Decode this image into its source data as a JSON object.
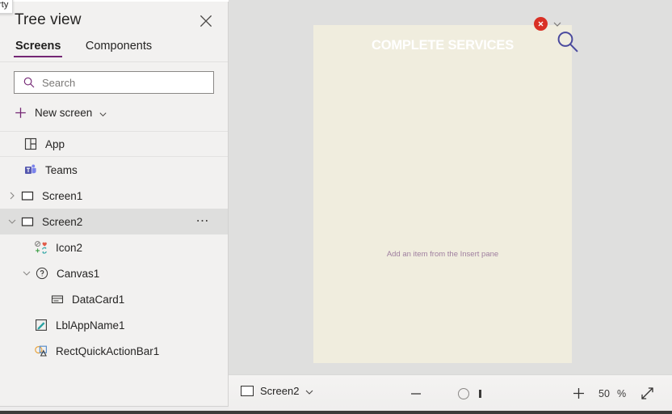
{
  "tooltip_fragment": "erty",
  "tree_view": {
    "title": "Tree view",
    "close_icon": "close-icon",
    "tabs": [
      {
        "label": "Screens",
        "active": true
      },
      {
        "label": "Components",
        "active": false
      }
    ],
    "search": {
      "placeholder": "Search",
      "value": "",
      "icon": "search-icon"
    },
    "new_screen": {
      "label": "New screen",
      "plus_icon": "plus-icon",
      "chevron_icon": "chevron-down-icon"
    },
    "items": [
      {
        "label": "App",
        "icon": "app-grid-icon",
        "indent": 0,
        "twisty": "none",
        "selected": false
      },
      {
        "label": "Teams",
        "icon": "teams-icon",
        "indent": 0,
        "twisty": "none",
        "selected": false
      },
      {
        "label": "Screen1",
        "icon": "screen-icon",
        "indent": 0,
        "twisty": "collapsed",
        "selected": false
      },
      {
        "label": "Screen2",
        "icon": "screen-icon",
        "indent": 0,
        "twisty": "expanded",
        "selected": true,
        "more_icon": "more-options-icon"
      },
      {
        "label": "Icon2",
        "icon": "icon-control-icon",
        "indent": 1,
        "twisty": "none",
        "selected": false
      },
      {
        "label": "Canvas1",
        "icon": "question-circle-icon",
        "indent": 1,
        "twisty": "expanded",
        "selected": false
      },
      {
        "label": "DataCard1",
        "icon": "datacard-icon",
        "indent": 2,
        "twisty": "none",
        "selected": false
      },
      {
        "label": "LblAppName1",
        "icon": "label-pencil-icon",
        "indent": 1,
        "twisty": "none",
        "selected": false
      },
      {
        "label": "RectQuickActionBar1",
        "icon": "shapes-icon",
        "indent": 1,
        "twisty": "none",
        "selected": false
      }
    ]
  },
  "canvas": {
    "error_badge": {
      "icon": "error-x-icon",
      "chevron_icon": "chevron-down-icon"
    },
    "app_screen": {
      "title": "COMPLETE SERVICES",
      "placeholder": "Add an item from the Insert pane",
      "search_icon": "search-icon",
      "background_color": "#F0EDDE",
      "title_color": "#FFFFFF",
      "placeholder_color": "#9F7F9F",
      "search_icon_color": "#4A4A9E"
    }
  },
  "bottom_bar": {
    "screen_selector": {
      "label": "Screen2",
      "screen_icon": "screen-icon",
      "chevron_icon": "chevron-down-icon"
    },
    "zoom_out_icon": "minus-icon",
    "zoom_in_icon": "plus-icon",
    "zoom_slider": "zoom-slider",
    "zoom_value": "50",
    "zoom_unit": "%",
    "fit_icon": "fit-to-screen-icon"
  },
  "colors": {
    "accent_purple": "#742774",
    "panel_bg": "#F2F1F0",
    "workspace_bg": "#DFDFDE",
    "selected_row": "#DEDEDD",
    "error_red": "#D93025"
  }
}
